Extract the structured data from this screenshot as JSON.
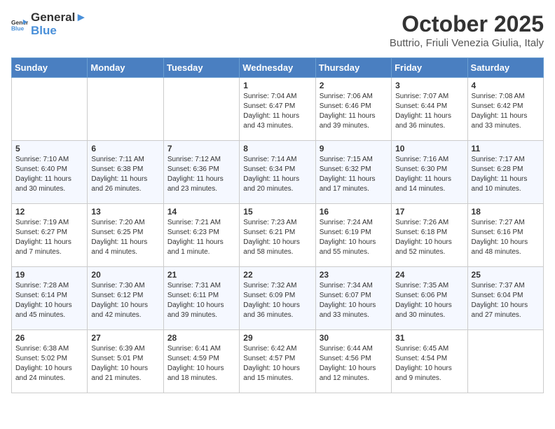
{
  "header": {
    "logo_line1": "General",
    "logo_line2": "Blue",
    "title": "October 2025",
    "subtitle": "Buttrio, Friuli Venezia Giulia, Italy"
  },
  "days_of_week": [
    "Sunday",
    "Monday",
    "Tuesday",
    "Wednesday",
    "Thursday",
    "Friday",
    "Saturday"
  ],
  "weeks": [
    [
      {
        "day": "",
        "info": ""
      },
      {
        "day": "",
        "info": ""
      },
      {
        "day": "",
        "info": ""
      },
      {
        "day": "1",
        "info": "Sunrise: 7:04 AM\nSunset: 6:47 PM\nDaylight: 11 hours\nand 43 minutes."
      },
      {
        "day": "2",
        "info": "Sunrise: 7:06 AM\nSunset: 6:46 PM\nDaylight: 11 hours\nand 39 minutes."
      },
      {
        "day": "3",
        "info": "Sunrise: 7:07 AM\nSunset: 6:44 PM\nDaylight: 11 hours\nand 36 minutes."
      },
      {
        "day": "4",
        "info": "Sunrise: 7:08 AM\nSunset: 6:42 PM\nDaylight: 11 hours\nand 33 minutes."
      }
    ],
    [
      {
        "day": "5",
        "info": "Sunrise: 7:10 AM\nSunset: 6:40 PM\nDaylight: 11 hours\nand 30 minutes."
      },
      {
        "day": "6",
        "info": "Sunrise: 7:11 AM\nSunset: 6:38 PM\nDaylight: 11 hours\nand 26 minutes."
      },
      {
        "day": "7",
        "info": "Sunrise: 7:12 AM\nSunset: 6:36 PM\nDaylight: 11 hours\nand 23 minutes."
      },
      {
        "day": "8",
        "info": "Sunrise: 7:14 AM\nSunset: 6:34 PM\nDaylight: 11 hours\nand 20 minutes."
      },
      {
        "day": "9",
        "info": "Sunrise: 7:15 AM\nSunset: 6:32 PM\nDaylight: 11 hours\nand 17 minutes."
      },
      {
        "day": "10",
        "info": "Sunrise: 7:16 AM\nSunset: 6:30 PM\nDaylight: 11 hours\nand 14 minutes."
      },
      {
        "day": "11",
        "info": "Sunrise: 7:17 AM\nSunset: 6:28 PM\nDaylight: 11 hours\nand 10 minutes."
      }
    ],
    [
      {
        "day": "12",
        "info": "Sunrise: 7:19 AM\nSunset: 6:27 PM\nDaylight: 11 hours\nand 7 minutes."
      },
      {
        "day": "13",
        "info": "Sunrise: 7:20 AM\nSunset: 6:25 PM\nDaylight: 11 hours\nand 4 minutes."
      },
      {
        "day": "14",
        "info": "Sunrise: 7:21 AM\nSunset: 6:23 PM\nDaylight: 11 hours\nand 1 minute."
      },
      {
        "day": "15",
        "info": "Sunrise: 7:23 AM\nSunset: 6:21 PM\nDaylight: 10 hours\nand 58 minutes."
      },
      {
        "day": "16",
        "info": "Sunrise: 7:24 AM\nSunset: 6:19 PM\nDaylight: 10 hours\nand 55 minutes."
      },
      {
        "day": "17",
        "info": "Sunrise: 7:26 AM\nSunset: 6:18 PM\nDaylight: 10 hours\nand 52 minutes."
      },
      {
        "day": "18",
        "info": "Sunrise: 7:27 AM\nSunset: 6:16 PM\nDaylight: 10 hours\nand 48 minutes."
      }
    ],
    [
      {
        "day": "19",
        "info": "Sunrise: 7:28 AM\nSunset: 6:14 PM\nDaylight: 10 hours\nand 45 minutes."
      },
      {
        "day": "20",
        "info": "Sunrise: 7:30 AM\nSunset: 6:12 PM\nDaylight: 10 hours\nand 42 minutes."
      },
      {
        "day": "21",
        "info": "Sunrise: 7:31 AM\nSunset: 6:11 PM\nDaylight: 10 hours\nand 39 minutes."
      },
      {
        "day": "22",
        "info": "Sunrise: 7:32 AM\nSunset: 6:09 PM\nDaylight: 10 hours\nand 36 minutes."
      },
      {
        "day": "23",
        "info": "Sunrise: 7:34 AM\nSunset: 6:07 PM\nDaylight: 10 hours\nand 33 minutes."
      },
      {
        "day": "24",
        "info": "Sunrise: 7:35 AM\nSunset: 6:06 PM\nDaylight: 10 hours\nand 30 minutes."
      },
      {
        "day": "25",
        "info": "Sunrise: 7:37 AM\nSunset: 6:04 PM\nDaylight: 10 hours\nand 27 minutes."
      }
    ],
    [
      {
        "day": "26",
        "info": "Sunrise: 6:38 AM\nSunset: 5:02 PM\nDaylight: 10 hours\nand 24 minutes."
      },
      {
        "day": "27",
        "info": "Sunrise: 6:39 AM\nSunset: 5:01 PM\nDaylight: 10 hours\nand 21 minutes."
      },
      {
        "day": "28",
        "info": "Sunrise: 6:41 AM\nSunset: 4:59 PM\nDaylight: 10 hours\nand 18 minutes."
      },
      {
        "day": "29",
        "info": "Sunrise: 6:42 AM\nSunset: 4:57 PM\nDaylight: 10 hours\nand 15 minutes."
      },
      {
        "day": "30",
        "info": "Sunrise: 6:44 AM\nSunset: 4:56 PM\nDaylight: 10 hours\nand 12 minutes."
      },
      {
        "day": "31",
        "info": "Sunrise: 6:45 AM\nSunset: 4:54 PM\nDaylight: 10 hours\nand 9 minutes."
      },
      {
        "day": "",
        "info": ""
      }
    ]
  ]
}
